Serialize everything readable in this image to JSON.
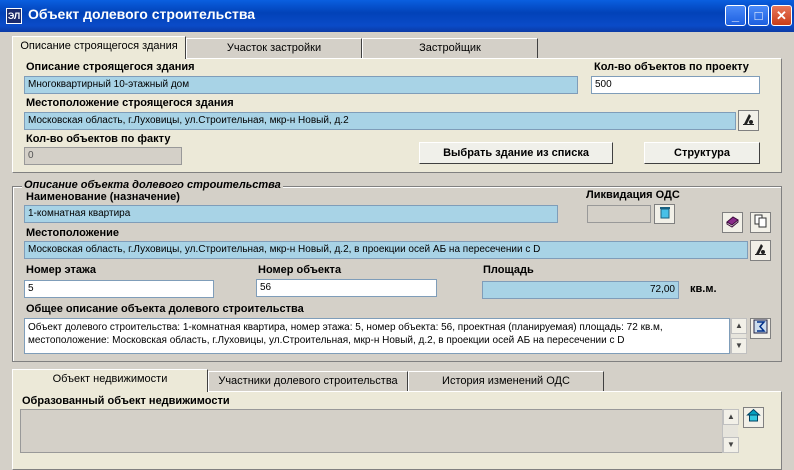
{
  "window": {
    "title": "Объект долевого строительства",
    "icon_label": "ЭЛ",
    "minimize": "_",
    "maximize": "□",
    "close": "✕"
  },
  "top_tabs": [
    "Описание строящегося здания",
    "Участок застройки",
    "Застройщик"
  ],
  "building": {
    "desc_label": "Описание строящегося здания",
    "desc_value": "Многоквартирный 10-этажный дом",
    "count_project_label": "Кол-во объектов по проекту",
    "count_project_value": "500",
    "location_label": "Местоположение строящегося здания",
    "location_value": "Московская область, г.Луховицы, ул.Строительная, мкр-н Новый, д.2",
    "count_fact_label": "Кол-во объектов по факту",
    "count_fact_value": "0",
    "select_button": "Выбрать здание из списка",
    "structure_button": "Структура"
  },
  "object": {
    "group_title": "Описание объекта долевого строительства",
    "name_label": "Наименование (назначение)",
    "name_value": "1-комнатная квартира",
    "liquidation_label": "Ликвидация ОДС",
    "liquidation_value": "",
    "location_label": "Местоположение",
    "location_value": "Московская область, г.Луховицы, ул.Строительная, мкр-н Новый, д.2, в проекции осей АБ на пересечении с D",
    "floor_label": "Номер этажа",
    "floor_value": "5",
    "number_label": "Номер объекта",
    "number_value": "56",
    "area_label": "Площадь",
    "area_value": "72,00",
    "area_unit": "кв.м.",
    "general_label": "Общее описание объекта долевого строительства",
    "general_value": "Объект долевого строительства: 1-комнатная квартира, номер этажа: 5, номер объекта: 56, проектная (планируемая) площадь: 72 кв.м, местоположение: Московская область, г.Луховицы, ул.Строительная, мкр-н Новый, д.2, в проекции осей АБ на пересечении с D"
  },
  "bottom_tabs": [
    "Объект недвижимости",
    "Участники долевого строительства",
    "История изменений ОДС"
  ],
  "realty": {
    "label": "Образованный объект недвижимости",
    "value": ""
  }
}
